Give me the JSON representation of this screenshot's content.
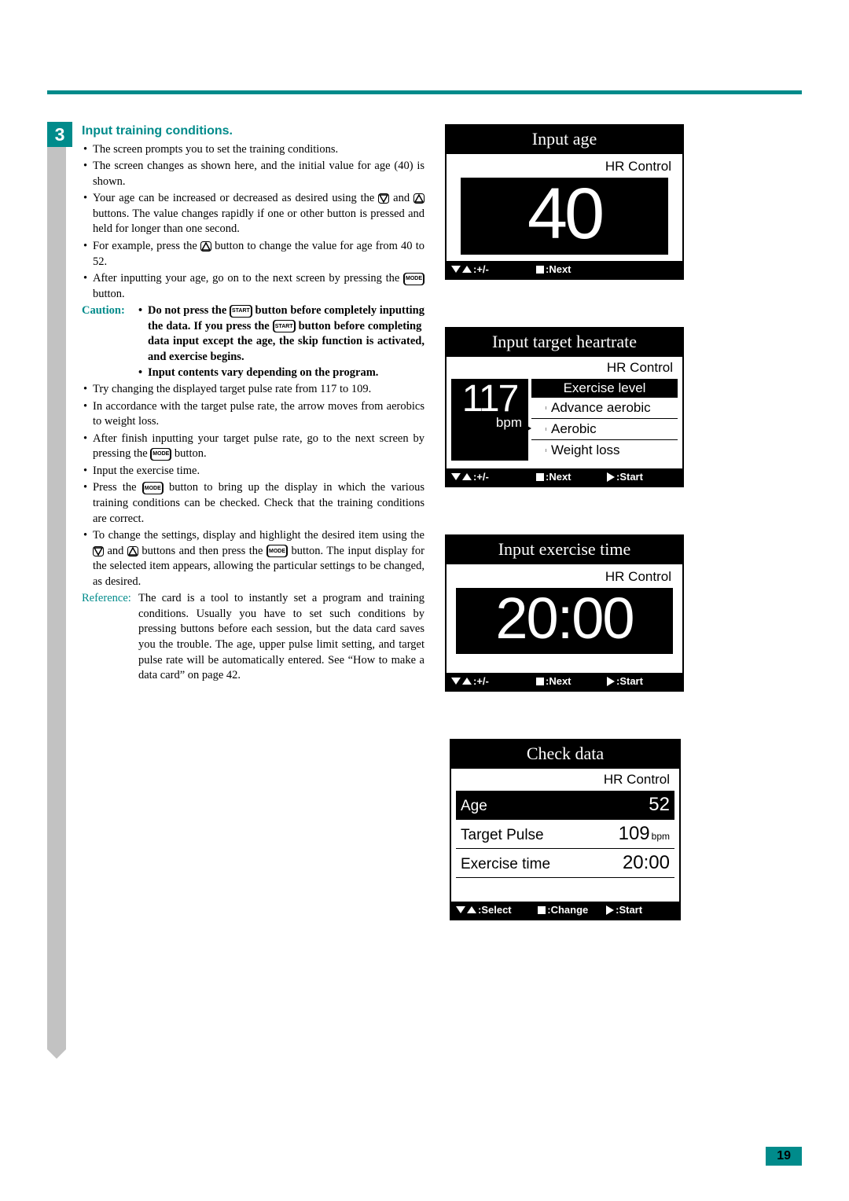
{
  "step_number": "3",
  "heading": "Input training conditions.",
  "bullets_a": [
    "The screen prompts you to set the training conditions.",
    "The screen changes as shown here, and the initial value for age (40) is shown.",
    "Your age can be increased or decreased as desired using the [down] and [up] buttons. The value changes rapidly if one or other button is pressed and held for longer than one second.",
    "For example, press the [up] button to change the value for age from 40 to 52.",
    "After inputting your age, go on to the next screen by pressing the [MODE] button."
  ],
  "caution": {
    "label": "Caution:",
    "items": [
      "Do not press the [START] button before completely inputting the data. If you press the [START] button before completing data input except the age, the skip function is activated, and exercise begins.",
      "Input contents vary depending on the program."
    ]
  },
  "bullets_b": [
    "Try changing the displayed target pulse rate from 117 to 109.",
    "In accordance with the target pulse rate, the arrow moves from aerobics to weight loss.",
    "After finish inputting your target pulse rate, go to the next screen by pressing the [MODE] button.",
    "Input the exercise time.",
    "Press the [MODE] button to bring up the display in which the various training conditions can be checked. Check that the training conditions are correct.",
    "To change the settings, display and highlight the desired item using the [down] and [up] buttons and then press the [MODE] button. The input display for the selected item appears, allowing the particular settings to be changed, as desired."
  ],
  "reference": {
    "label": "Reference:",
    "text": "The card is a tool to instantly set a program and training conditions. Usually you have to set such conditions by pressing buttons before each session, but the data card saves you the trouble. The age, upper pulse limit setting, and target pulse rate will be automatically entered. See “How to make a data card” on page 42."
  },
  "screens": {
    "age": {
      "title": "Input age",
      "hr_label": "HR Control",
      "value": "40",
      "footer": {
        "left": ":+/-",
        "mid": ":Next"
      }
    },
    "heartrate": {
      "title": "Input target heartrate",
      "hr_label": "HR Control",
      "value": "117",
      "unit": "bpm",
      "level_header": "Exercise level",
      "levels": [
        "Advance aerobic",
        "Aerobic",
        "Weight loss"
      ],
      "selected_index": 1,
      "footer": {
        "left": ":+/-",
        "mid": ":Next",
        "right": ":Start"
      }
    },
    "time": {
      "title": "Input exercise time",
      "hr_label": "HR Control",
      "value": "20:00",
      "footer": {
        "left": ":+/-",
        "mid": ":Next",
        "right": ":Start"
      }
    },
    "check": {
      "title": "Check data",
      "hr_label": "HR Control",
      "rows": [
        {
          "label": "Age",
          "value": "52",
          "unit": "",
          "highlight": true
        },
        {
          "label": "Target Pulse",
          "value": "109",
          "unit": "bpm",
          "highlight": false
        },
        {
          "label": "Exercise time",
          "value": "20:00",
          "unit": "",
          "highlight": false
        }
      ],
      "footer": {
        "left": ":Select",
        "mid": ":Change",
        "right": ":Start"
      }
    }
  },
  "icons": {
    "mode_label": "MODE",
    "start_label": "START"
  },
  "page_number": "19"
}
